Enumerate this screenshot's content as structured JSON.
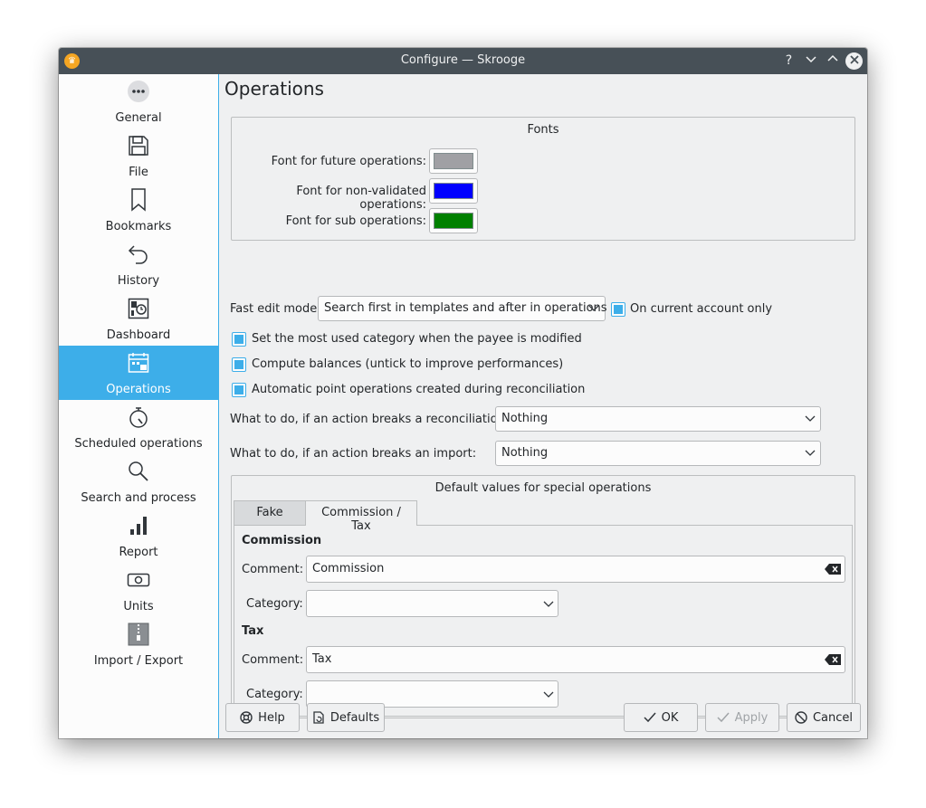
{
  "window": {
    "title": "Configure — Skrooge",
    "buttons": {
      "help": "?",
      "minimize": "⌄",
      "maximize": "⌃",
      "close": "✕"
    }
  },
  "sidebar": {
    "items": [
      {
        "label": "General",
        "icon": "more-icon"
      },
      {
        "label": "File",
        "icon": "save-icon"
      },
      {
        "label": "Bookmarks",
        "icon": "bookmark-icon"
      },
      {
        "label": "History",
        "icon": "undo-icon"
      },
      {
        "label": "Dashboard",
        "icon": "dashboard-icon"
      },
      {
        "label": "Operations",
        "icon": "calendar-icon",
        "active": true
      },
      {
        "label": "Scheduled operations",
        "icon": "timer-icon"
      },
      {
        "label": "Search and process",
        "icon": "search-icon"
      },
      {
        "label": "Report",
        "icon": "bar-chart-icon"
      },
      {
        "label": "Units",
        "icon": "money-icon"
      },
      {
        "label": "Import / Export",
        "icon": "archive-icon"
      }
    ]
  },
  "page": {
    "title": "Operations",
    "fonts": {
      "title": "Fonts",
      "future_label": "Font for future operations:",
      "future_color": "#a0a0a4",
      "nonvalidated_label": "Font for non-validated operations:",
      "nonvalidated_color": "#0000ff",
      "sub_label": "Font for sub operations:",
      "sub_color": "#008000"
    },
    "fast_edit": {
      "label": "Fast edit mode:",
      "value": "Search first in templates and after in operations",
      "current_account_label": "On current account only",
      "current_account_checked": true
    },
    "options": {
      "most_used_category": "Set the most used category when the payee is modified",
      "compute_balances": "Compute balances (untick to improve performances)",
      "auto_point": "Automatic point operations created during reconciliation"
    },
    "reconciliation": {
      "label": "What to do, if an action breaks a reconciliation:",
      "value": "Nothing"
    },
    "import": {
      "label": "What to do, if an action breaks an import:",
      "value": "Nothing"
    },
    "defaults": {
      "title": "Default values for special operations",
      "tabs": [
        "Fake",
        "Commission / Tax"
      ],
      "active_tab": "Commission / Tax",
      "commission": {
        "heading": "Commission",
        "comment_label": "Comment:",
        "comment_value": "Commission",
        "category_label": "Category:",
        "category_value": ""
      },
      "tax": {
        "heading": "Tax",
        "comment_label": "Comment:",
        "comment_value": "Tax",
        "category_label": "Category:",
        "category_value": ""
      }
    }
  },
  "footer": {
    "help": "Help",
    "defaults": "Defaults",
    "ok": "OK",
    "apply": "Apply",
    "cancel": "Cancel"
  },
  "colors": {
    "accent": "#3daee9",
    "titlebar": "#475057",
    "window_bg": "#eff0f1"
  }
}
